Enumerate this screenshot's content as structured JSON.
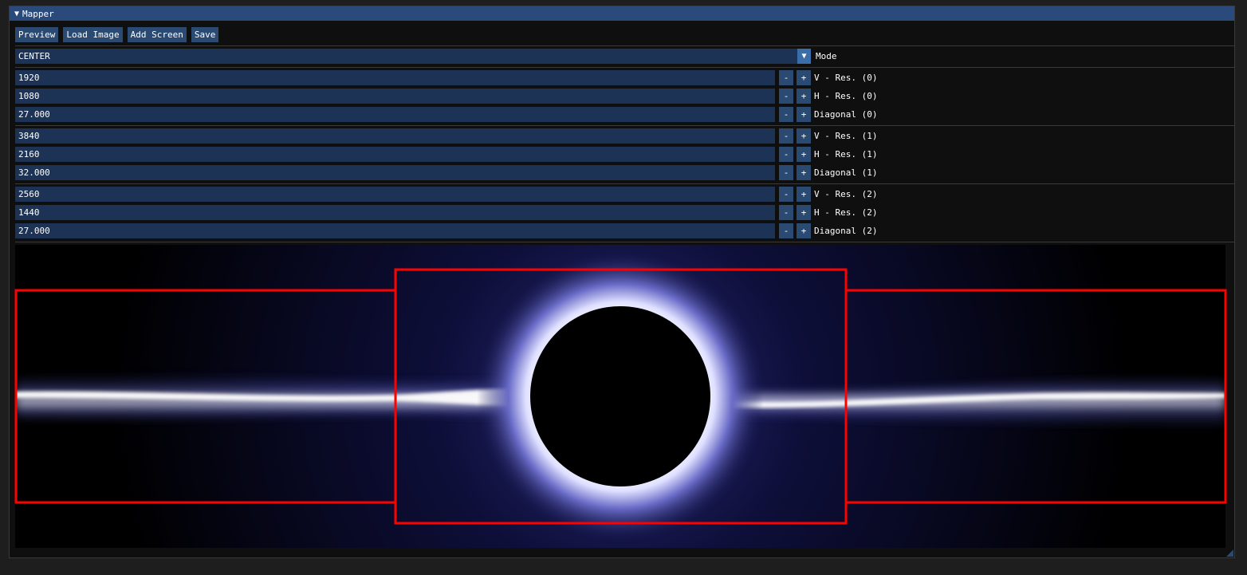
{
  "window": {
    "title": "Mapper"
  },
  "toolbar": {
    "preview": "Preview",
    "load_image": "Load Image",
    "add_screen": "Add Screen",
    "save": "Save"
  },
  "mode": {
    "value": "CENTER",
    "label": "Mode"
  },
  "screens": [
    {
      "v_res": "1920",
      "v_label": "V - Res. (0)",
      "h_res": "1080",
      "h_label": "H - Res. (0)",
      "diag": "27.000",
      "d_label": "Diagonal (0)"
    },
    {
      "v_res": "3840",
      "v_label": "V - Res. (1)",
      "h_res": "2160",
      "h_label": "H - Res. (1)",
      "diag": "32.000",
      "d_label": "Diagonal (1)"
    },
    {
      "v_res": "2560",
      "v_label": "V - Res. (2)",
      "h_res": "1440",
      "h_label": "H - Res. (2)",
      "diag": "27.000",
      "d_label": "Diagonal (2)"
    }
  ],
  "stepper": {
    "minus": "-",
    "plus": "+"
  },
  "colors": {
    "title_bar": "#294a7a",
    "button": "#2a4a72",
    "field": "#1d3355",
    "screen_outline": "#ff0000"
  }
}
